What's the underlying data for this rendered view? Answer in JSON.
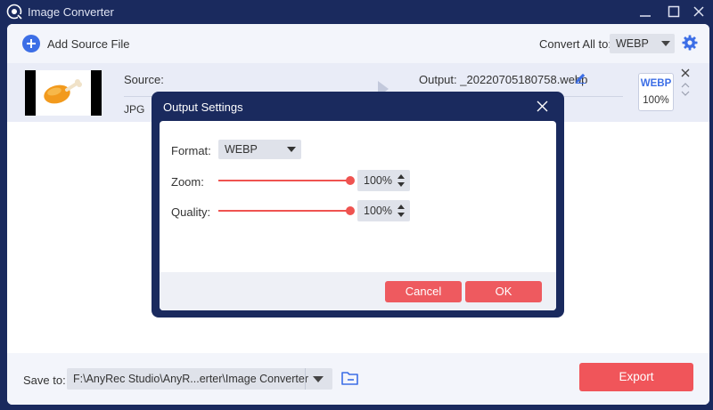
{
  "window": {
    "title": "Image Converter",
    "icons": {
      "app": "app-logo-icon",
      "minimize": "minimize-icon",
      "maximize": "maximize-icon",
      "close": "close-icon"
    }
  },
  "toolbar": {
    "add_source_label": "Add Source File",
    "convert_all_label": "Convert All to:",
    "convert_all_value": "WEBP",
    "settings_icon": "gear-icon"
  },
  "file_row": {
    "source_label": "Source:",
    "source_format": "JPG",
    "source_info_partial": "1",
    "output_label": "Output: _20220705180758.webp",
    "badge_format": "WEBP",
    "badge_zoom": "100%",
    "thumbnail": "chicken-leg-image"
  },
  "bottom": {
    "save_to_label": "Save to:",
    "save_path": "F:\\AnyRec Studio\\AnyR...erter\\Image Converter",
    "export_label": "Export"
  },
  "dialog": {
    "title": "Output Settings",
    "format_label": "Format:",
    "format_value": "WEBP",
    "zoom_label": "Zoom:",
    "zoom_value": "100%",
    "zoom_level": 1.0,
    "quality_label": "Quality:",
    "quality_value": "100%",
    "quality_level": 1.0,
    "cancel_label": "Cancel",
    "ok_label": "OK"
  },
  "colors": {
    "frame": "#1a2a5e",
    "accent_blue": "#3c6ee6",
    "accent_red": "#f0555a"
  }
}
